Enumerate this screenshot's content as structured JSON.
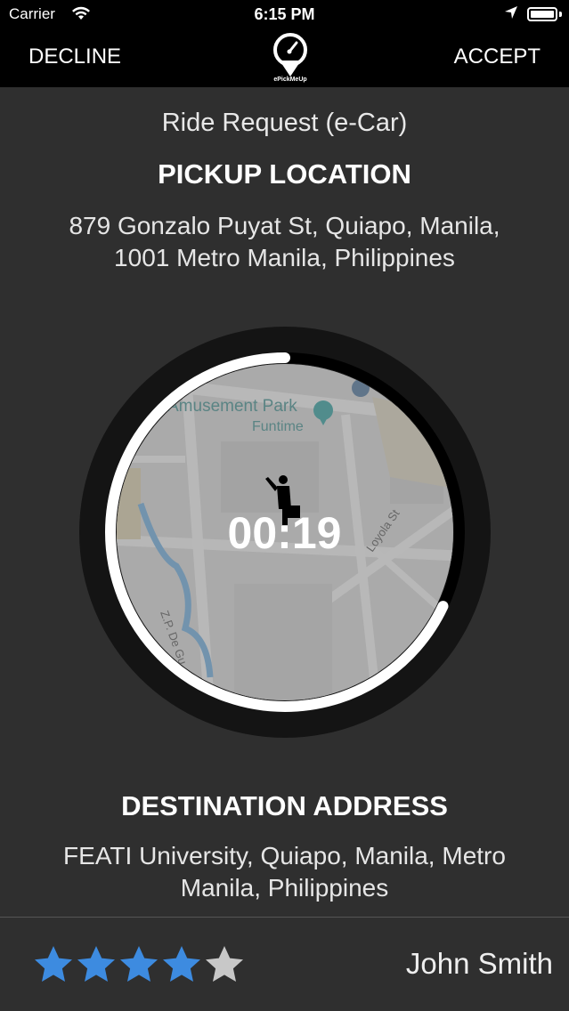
{
  "status_bar": {
    "carrier": "Carrier",
    "time": "6:15 PM",
    "wifi_icon": "wifi-icon",
    "location_icon": "location-arrow-icon",
    "battery_icon": "battery-icon"
  },
  "navbar": {
    "decline_label": "DECLINE",
    "accept_label": "ACCEPT",
    "logo_text": "ePickMeUp"
  },
  "request": {
    "title": "Ride Request (e-Car)",
    "pickup_heading": "PICKUP LOCATION",
    "pickup_address_line1": "879 Gonzalo Puyat St,  Quiapo,  Manila,",
    "pickup_address_line2": "1001 Metro Manila,  Philippines"
  },
  "map": {
    "label_park": "Amusement Park",
    "label_funtime": "Funtime",
    "label_street1": "Loyola St",
    "label_street2": "Z.P. De Gu",
    "passenger_icon": "passenger-hailing-icon"
  },
  "timer": {
    "value": "00:19",
    "progress_remaining": 0.68
  },
  "destination": {
    "heading": "DESTINATION ADDRESS",
    "address_line1": "FEATI University, Quiapo, Manila, Metro",
    "address_line2": "Manila, Philippines"
  },
  "passenger": {
    "rating": 4,
    "max_rating": 5,
    "name": "John Smith"
  },
  "colors": {
    "star_filled": "#3d8be0",
    "star_empty": "#c8c8c8",
    "background": "#2f2f2f"
  }
}
